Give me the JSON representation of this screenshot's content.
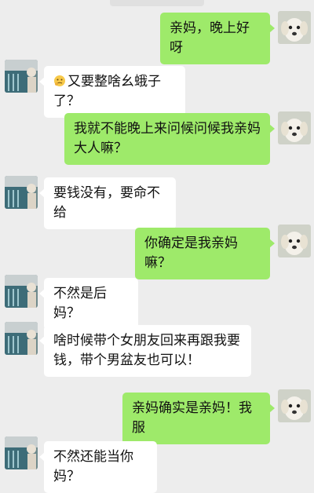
{
  "chat": {
    "avatars": {
      "me": "puppy-avatar",
      "other": "pool-photo-avatar"
    },
    "messages": [
      {
        "side": "me",
        "text": "亲妈，晚上好呀"
      },
      {
        "side": "other",
        "emoji": "thinking-emoji",
        "text": "又要整啥幺蛾子了？"
      },
      {
        "side": "me",
        "text": "我就不能晚上来问候问候我亲妈大人嘛？"
      },
      {
        "side": "other",
        "text": "要钱没有，要命不给"
      },
      {
        "side": "me",
        "text": "你确定是我亲妈嘛？"
      },
      {
        "side": "other",
        "text": "不然是后妈？"
      },
      {
        "side": "other",
        "text": "啥时候带个女朋友回来再跟我要钱，带个男盆友也可以！"
      },
      {
        "side": "me",
        "text": "亲妈确实是亲妈！我服"
      },
      {
        "side": "other",
        "text": "不然还能当你妈？"
      }
    ]
  },
  "colors": {
    "background": "#ededed",
    "sent_bubble": "#9eea6a",
    "received_bubble": "#ffffff"
  }
}
